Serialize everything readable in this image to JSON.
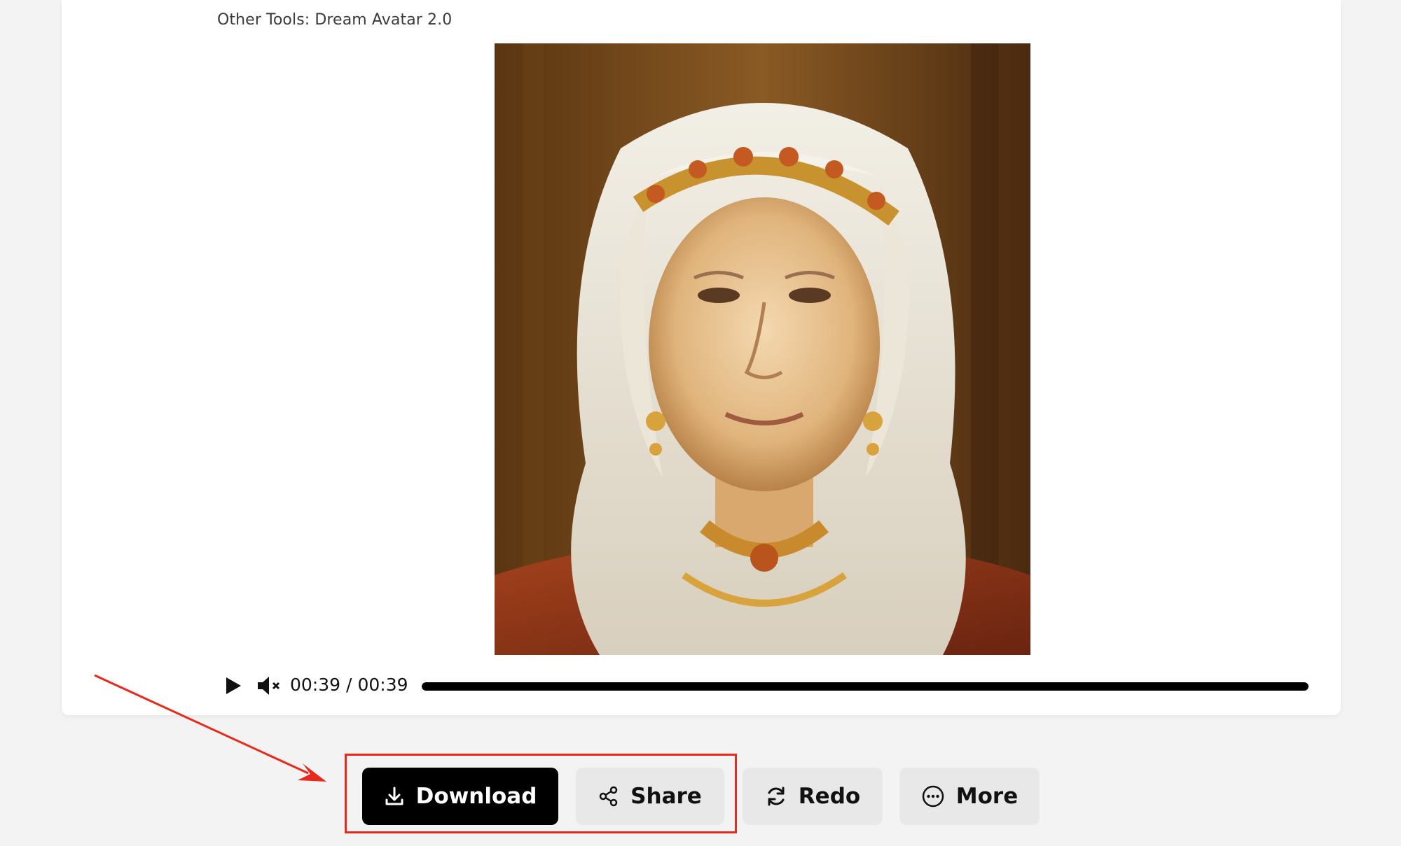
{
  "header": {
    "tools_label": "Other Tools: Dream Avatar 2.0"
  },
  "player": {
    "current_time": "00:39",
    "separator": "/",
    "duration": "00:39",
    "progress_fraction": 1.0
  },
  "actions": {
    "download_label": "Download",
    "share_label": "Share",
    "redo_label": "Redo",
    "more_label": "More"
  },
  "icons": {
    "play": "play-icon",
    "mute": "muted-speaker-icon",
    "download": "download-icon",
    "share": "share-icon",
    "redo": "redo-icon",
    "more": "more-icon"
  },
  "colors": {
    "page_bg": "#f3f3f3",
    "card_bg": "#ffffff",
    "primary_button": "#000000",
    "secondary_button": "#e8e8e8",
    "annotation": "#e8291b"
  }
}
